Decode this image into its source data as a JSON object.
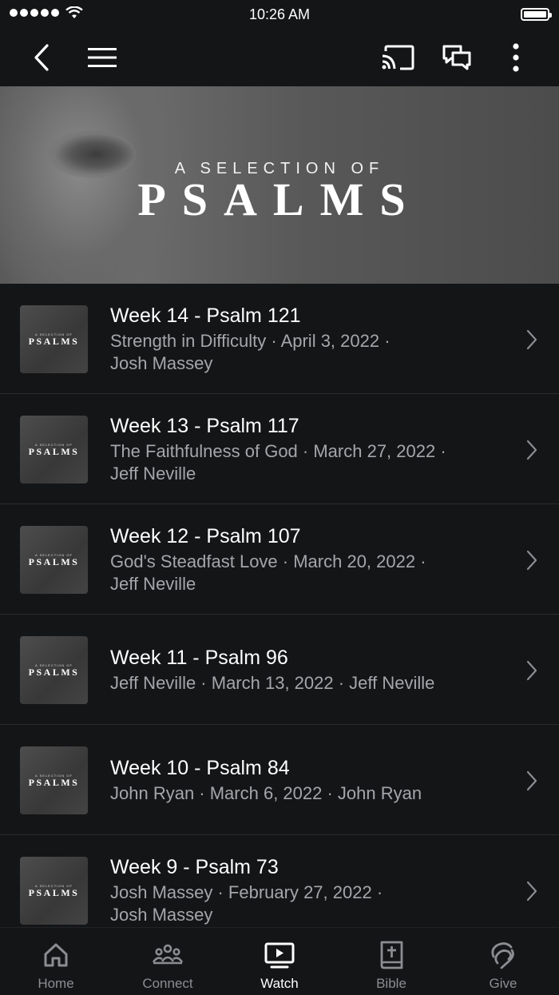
{
  "status_bar": {
    "time": "10:26 AM"
  },
  "nav": {
    "back_icon": "back-chevron-icon",
    "menu_icon": "hamburger-icon",
    "cast_icon": "cast-icon",
    "chat_icon": "chat-icon",
    "more_icon": "more-vertical-icon"
  },
  "banner": {
    "subtitle": "A SELECTION OF",
    "title": "PSALMS"
  },
  "thumbnail": {
    "subtitle": "A SELECTION OF",
    "title": "PSALMS"
  },
  "items": [
    {
      "title": "Week 14 - Psalm 121",
      "meta_line1": "Strength in Difficulty · April 3, 2022 ·",
      "meta_line2": "Josh Massey"
    },
    {
      "title": "Week 13 - Psalm 117",
      "meta_line1": "The Faithfulness of God · March 27, 2022 ·",
      "meta_line2": "Jeff Neville"
    },
    {
      "title": "Week 12 - Psalm 107",
      "meta_line1": "God's Steadfast Love · March 20, 2022 ·",
      "meta_line2": "Jeff Neville"
    },
    {
      "title": "Week 11 - Psalm 96",
      "meta_line1": "Jeff Neville · March 13, 2022 · Jeff Neville",
      "meta_line2": ""
    },
    {
      "title": "Week 10 - Psalm 84",
      "meta_line1": "John Ryan · March 6, 2022 · John Ryan",
      "meta_line2": ""
    },
    {
      "title": "Week 9 - Psalm 73",
      "meta_line1": "Josh Massey · February 27, 2022 ·",
      "meta_line2": "Josh Massey"
    }
  ],
  "tabs": [
    {
      "label": "Home",
      "icon": "home-icon",
      "active": false
    },
    {
      "label": "Connect",
      "icon": "people-icon",
      "active": false
    },
    {
      "label": "Watch",
      "icon": "tv-play-icon",
      "active": true
    },
    {
      "label": "Bible",
      "icon": "bible-icon",
      "active": false
    },
    {
      "label": "Give",
      "icon": "give-icon",
      "active": false
    }
  ],
  "colors": {
    "background": "#141517",
    "text_primary": "#ffffff",
    "text_secondary": "#a4a6ab",
    "tab_inactive": "#8b8d92",
    "divider": "#2b2c2f"
  }
}
